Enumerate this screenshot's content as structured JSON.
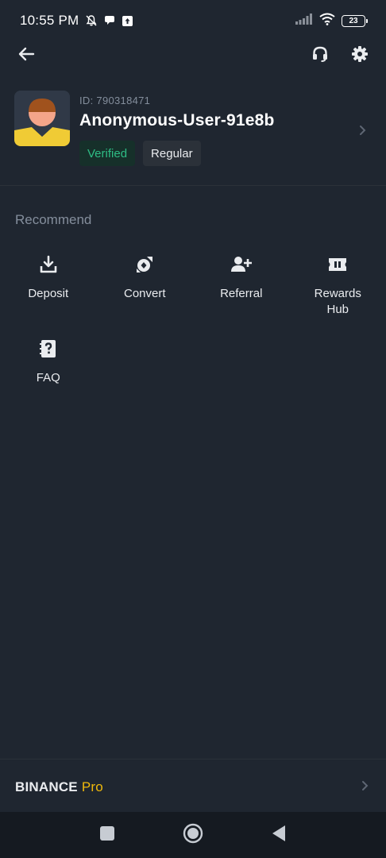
{
  "status_bar": {
    "time": "10:55 PM",
    "battery_level": "23",
    "icons": [
      "mute-bell-icon",
      "chat-bubble-icon",
      "upload-box-icon",
      "signal-icon",
      "wifi-icon",
      "battery-icon"
    ]
  },
  "top_nav": {
    "icons": [
      "back-arrow-icon",
      "headset-icon",
      "settings-gear-icon"
    ]
  },
  "profile": {
    "id_text": "ID: 790318471",
    "username": "Anonymous-User-91e8b",
    "badges": [
      "Verified",
      "Regular"
    ]
  },
  "recommend": {
    "title": "Recommend",
    "items": [
      {
        "label": "Deposit",
        "icon": "download-tray-icon"
      },
      {
        "label": "Convert",
        "icon": "convert-icon"
      },
      {
        "label": "Referral",
        "icon": "add-user-icon"
      },
      {
        "label": "Rewards Hub",
        "icon": "ticket-icon"
      },
      {
        "label": "FAQ",
        "icon": "question-book-icon"
      }
    ]
  },
  "footer": {
    "brand": "BINANCE",
    "accent": "Pro"
  },
  "colors": {
    "background": "#1f2630",
    "accent_yellow": "#f0b90b",
    "verified_green": "#2ebd85",
    "muted_text": "#848e9c"
  },
  "android_nav": {
    "icons": [
      "recents-square-icon",
      "home-circle-icon",
      "back-triangle-icon"
    ]
  }
}
